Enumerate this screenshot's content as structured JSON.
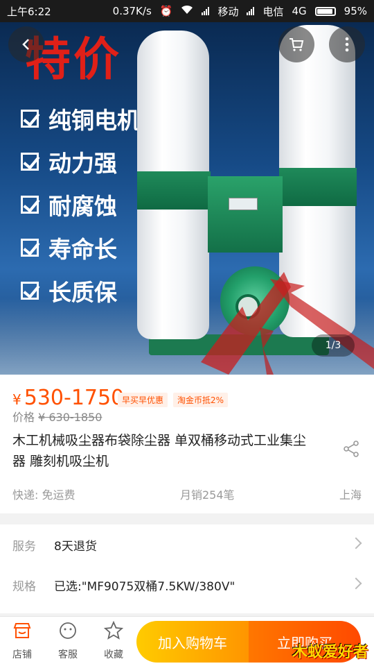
{
  "status_bar": {
    "time": "上午6:22",
    "speed": "0.37K/s",
    "carrier1": "移动",
    "carrier2": "电信",
    "network": "4G",
    "battery": "95%"
  },
  "gallery": {
    "promo_text": "特价",
    "features": [
      "纯铜电机",
      "动力强",
      "耐腐蚀",
      "寿命长",
      "长质保"
    ],
    "pager": "1/3"
  },
  "product": {
    "currency": "¥",
    "price_range": "530-1750",
    "tags": [
      "早买早优惠",
      "淘金币抵2%"
    ],
    "original_label": "价格",
    "original_price": "¥ 630-1850",
    "title": "木工机械吸尘器布袋除尘器 单双桶移动式工业集尘器 雕刻机吸尘机",
    "shipping": "快递: 免运费",
    "monthly_sales": "月销254笔",
    "location": "上海"
  },
  "services": {
    "service_label": "服务",
    "service_value": "8天退货",
    "spec_label": "规格",
    "spec_value": "已选:\"MF9075双桶7.5KW/380V\""
  },
  "bottom_bar": {
    "shop_label": "店铺",
    "service_label": "客服",
    "favorite_label": "收藏",
    "add_to_cart": "加入购物车",
    "buy_now": "立即购买",
    "watermark": "木蚁爱好者"
  },
  "colors": {
    "accent": "#ff5000",
    "cart_button": "#ffa200",
    "buy_button": "#ff5a00"
  }
}
